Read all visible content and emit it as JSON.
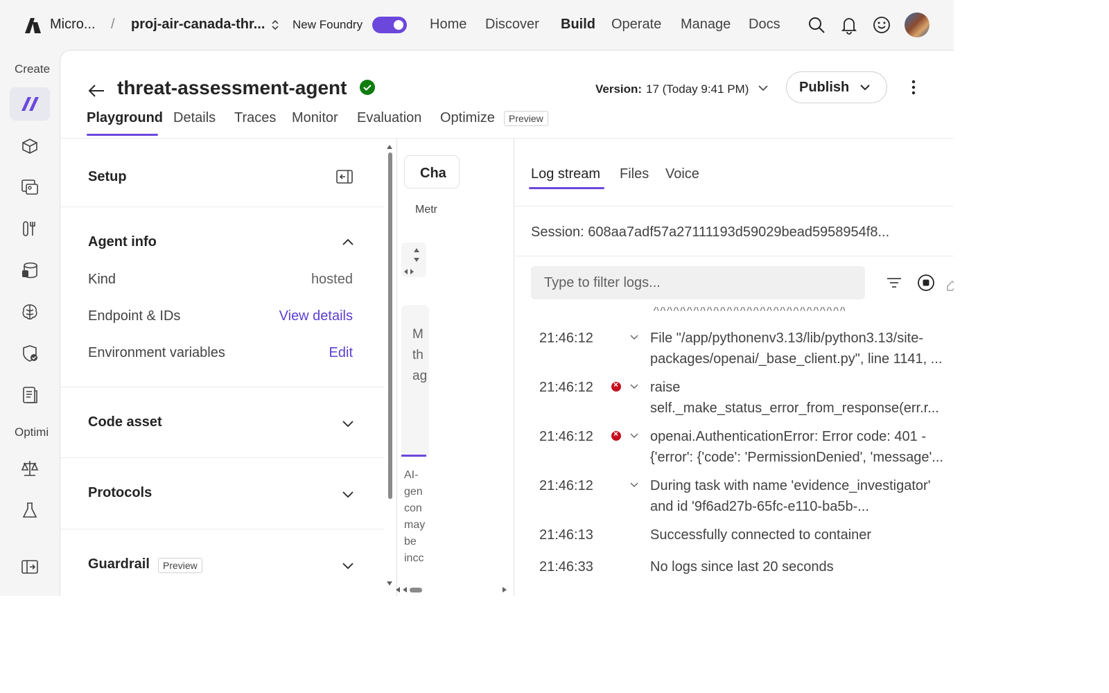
{
  "header": {
    "brand": "Micro...",
    "separator": "/",
    "project": "proj-air-canada-thr...",
    "new_foundry_label": "New Foundry",
    "new_foundry_enabled": true,
    "nav": [
      "Home",
      "Discover",
      "Build",
      "Operate",
      "Manage",
      "Docs"
    ],
    "active_nav": "Build",
    "icons": [
      "search-icon",
      "bell-icon",
      "smiley-icon",
      "avatar"
    ]
  },
  "rail": {
    "create_label": "Create",
    "optimize_label": "Optimi",
    "icons": [
      "agents-icon",
      "models-icon",
      "images-icon",
      "tools-icon",
      "data-icon",
      "brain-icon",
      "shield-icon",
      "document-icon",
      "scale-icon",
      "flask-icon",
      "expand-icon"
    ]
  },
  "agent": {
    "title": "threat-assessment-agent",
    "status": "ok",
    "version_label": "Version:",
    "version_value": "17 (Today 9:41 PM)",
    "publish_label": "Publish"
  },
  "tabs": {
    "items": [
      "Playground",
      "Details",
      "Traces",
      "Monitor",
      "Evaluation",
      "Optimize"
    ],
    "active": "Playground",
    "optimize_badge": "Preview"
  },
  "setup": {
    "title": "Setup",
    "agent_info_title": "Agent info",
    "kind_label": "Kind",
    "kind_value": "hosted",
    "endpoint_label": "Endpoint & IDs",
    "endpoint_link": "View details",
    "env_label": "Environment variables",
    "env_link": "Edit",
    "code_asset_title": "Code asset",
    "protocols_title": "Protocols",
    "guardrail_title": "Guardrail",
    "guardrail_badge": "Preview"
  },
  "chat": {
    "tab_label": "Cha",
    "metrics_label": "Metr",
    "message_text": "M\nth\nag",
    "ai_note": "AI-\ngen\ncon\nmay\nbe\nincc"
  },
  "logs": {
    "tabs": [
      "Log stream",
      "Files",
      "Voice"
    ],
    "active_tab": "Log stream",
    "session": "Session: 608aa7adf57a27111193d59029bead5958954f8...",
    "filter_placeholder": "Type to filter logs...",
    "carets": "^^^^^^^^^^^^^^^^^^^^^^^^^^^^^",
    "entries": [
      {
        "time": "21:46:12",
        "error": false,
        "expandable": true,
        "message": "File \"/app/pythonenv3.13/lib/python3.13/site-\npackages/openai/_base_client.py\", line 1141, ..."
      },
      {
        "time": "21:46:12",
        "error": true,
        "expandable": true,
        "message": "raise\nself._make_status_error_from_response(err.r..."
      },
      {
        "time": "21:46:12",
        "error": true,
        "expandable": true,
        "message": "openai.AuthenticationError: Error code: 401 -\n{'error': {'code': 'PermissionDenied', 'message'..."
      },
      {
        "time": "21:46:12",
        "error": false,
        "expandable": true,
        "message": "During task with name 'evidence_investigator'\nand id '9f6ad27b-65fc-e110-ba5b-..."
      },
      {
        "time": "21:46:13",
        "error": false,
        "expandable": false,
        "message": "Successfully connected to container"
      },
      {
        "time": "21:46:33",
        "error": false,
        "expandable": false,
        "message": "No logs since last 20 seconds"
      }
    ]
  },
  "colors": {
    "accent": "#6b47dc",
    "link": "#5b3fd0",
    "success": "#107c10",
    "error": "#c50f1f"
  }
}
